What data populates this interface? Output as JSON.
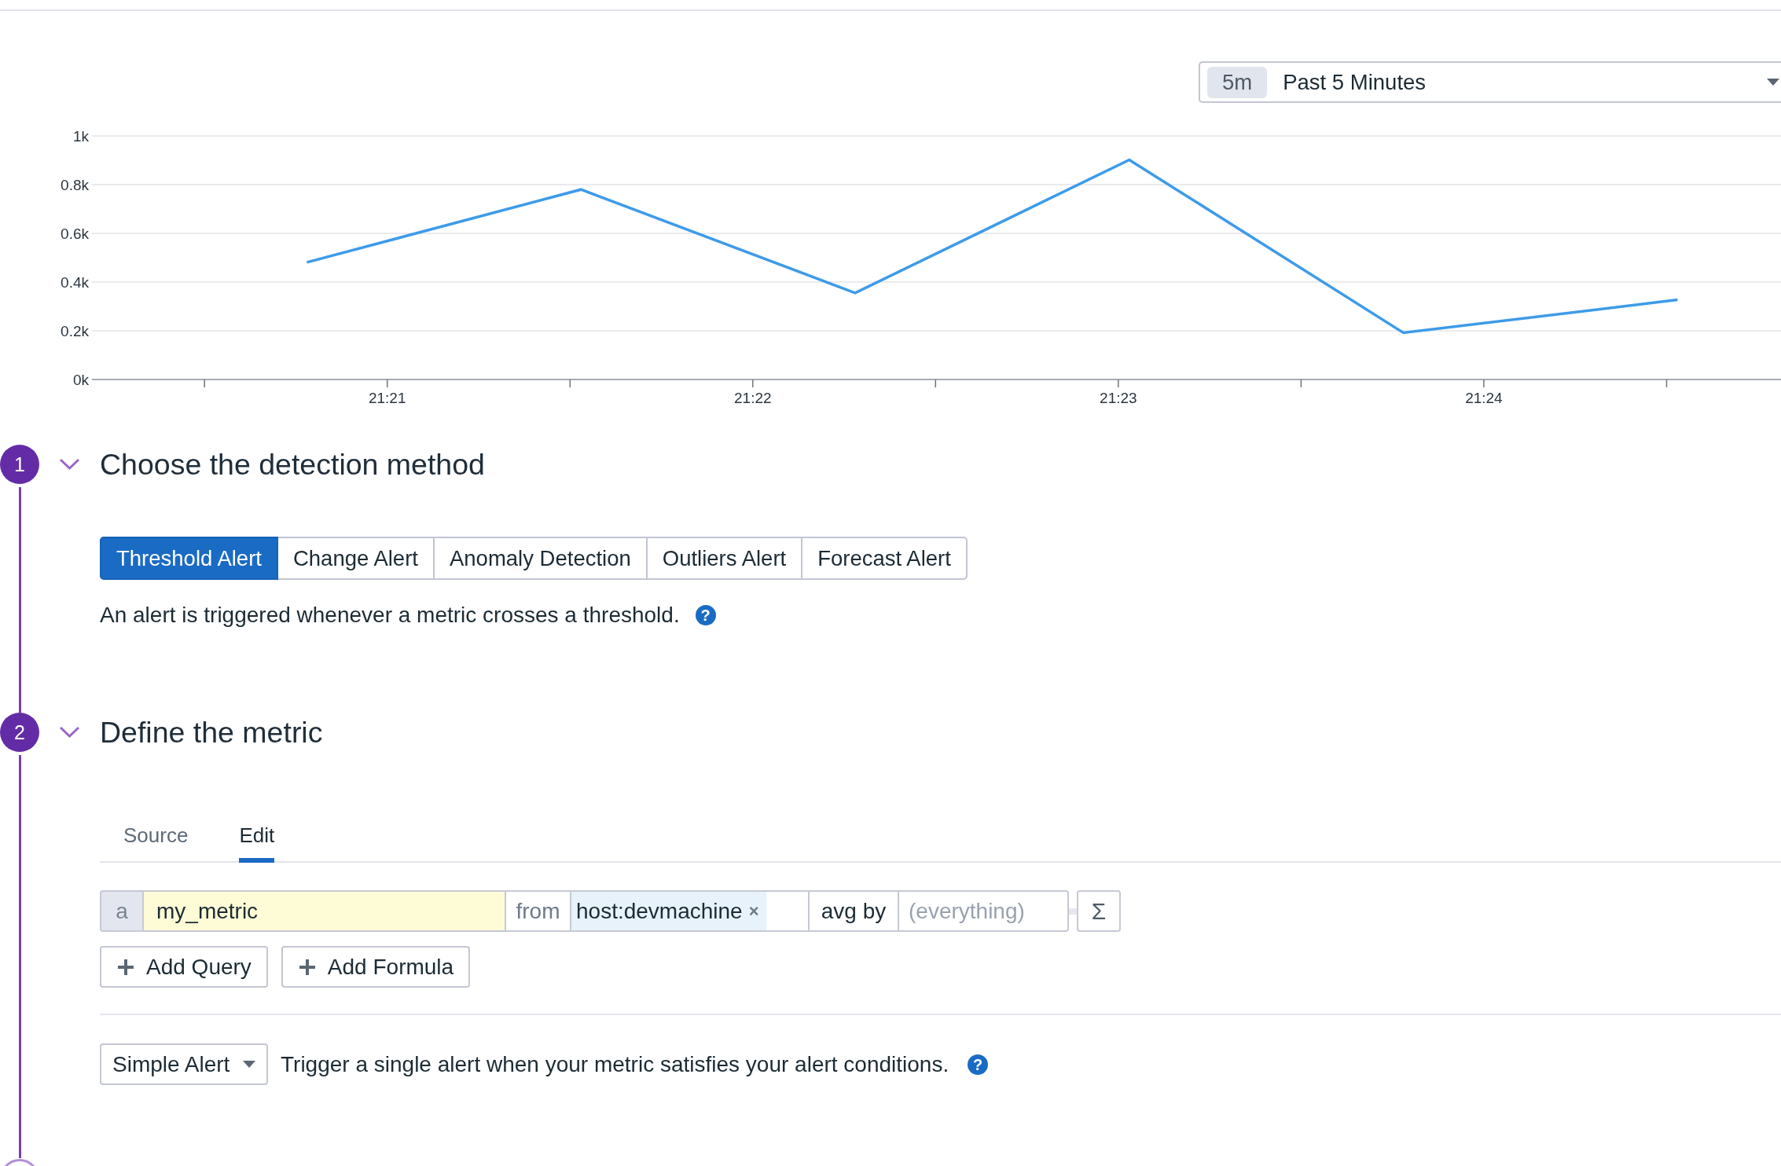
{
  "time_picker": {
    "badge": "5m",
    "label": "Past 5 Minutes"
  },
  "chart": {
    "chart_data": {
      "type": "line",
      "grid": true,
      "x": [
        1280.78,
        1281.53,
        1282.28,
        1283.03,
        1283.78,
        1284.53
      ],
      "values": [
        481,
        780,
        355,
        902,
        192,
        327
      ],
      "xlim": [
        1280.205,
        1284.813
      ],
      "ylim": [
        0,
        1000
      ],
      "xticks": [
        {
          "value": 1281,
          "label": "21:21"
        },
        {
          "value": 1282,
          "label": "21:22"
        },
        {
          "value": 1283,
          "label": "21:23"
        },
        {
          "value": 1284,
          "label": "21:24"
        }
      ],
      "yticks": [
        {
          "value": 0,
          "label": "0k"
        },
        {
          "value": 200,
          "label": "0.2k"
        },
        {
          "value": 400,
          "label": "0.4k"
        },
        {
          "value": 600,
          "label": "0.6k"
        },
        {
          "value": 800,
          "label": "0.8k"
        },
        {
          "value": 1000,
          "label": "1k"
        }
      ]
    }
  },
  "steps": [
    {
      "kind": "detection",
      "number": "1",
      "active": true,
      "expanded": true,
      "title": "Choose the detection method",
      "detection_methods": [
        {
          "label": "Threshold Alert",
          "selected": true
        },
        {
          "label": "Change Alert",
          "selected": false
        },
        {
          "label": "Anomaly Detection",
          "selected": false
        },
        {
          "label": "Outliers Alert",
          "selected": false
        },
        {
          "label": "Forecast Alert",
          "selected": false
        }
      ],
      "description": "An alert is triggered whenever a metric crosses a threshold.",
      "help": "?"
    },
    {
      "kind": "metric",
      "number": "2",
      "active": true,
      "expanded": true,
      "title": "Define the metric",
      "tabs": [
        {
          "label": "Source",
          "selected": false
        },
        {
          "label": "Edit",
          "selected": true
        }
      ],
      "query": {
        "name": "a",
        "metric": "my_metric",
        "from_label": "from",
        "tags": [
          {
            "label": "host:devmachine",
            "remove": "×"
          }
        ],
        "aggregation": "avg by",
        "group_placeholder": "(everything)",
        "function_button": "Σ"
      },
      "buttons": [
        {
          "label": "Add Query"
        },
        {
          "label": "Add Formula"
        }
      ],
      "alert_type": {
        "value": "Simple Alert",
        "description": "Trigger a single alert when your metric satisfies your alert conditions.",
        "help": "?"
      }
    },
    {
      "kind": "pending",
      "active": false
    }
  ]
}
